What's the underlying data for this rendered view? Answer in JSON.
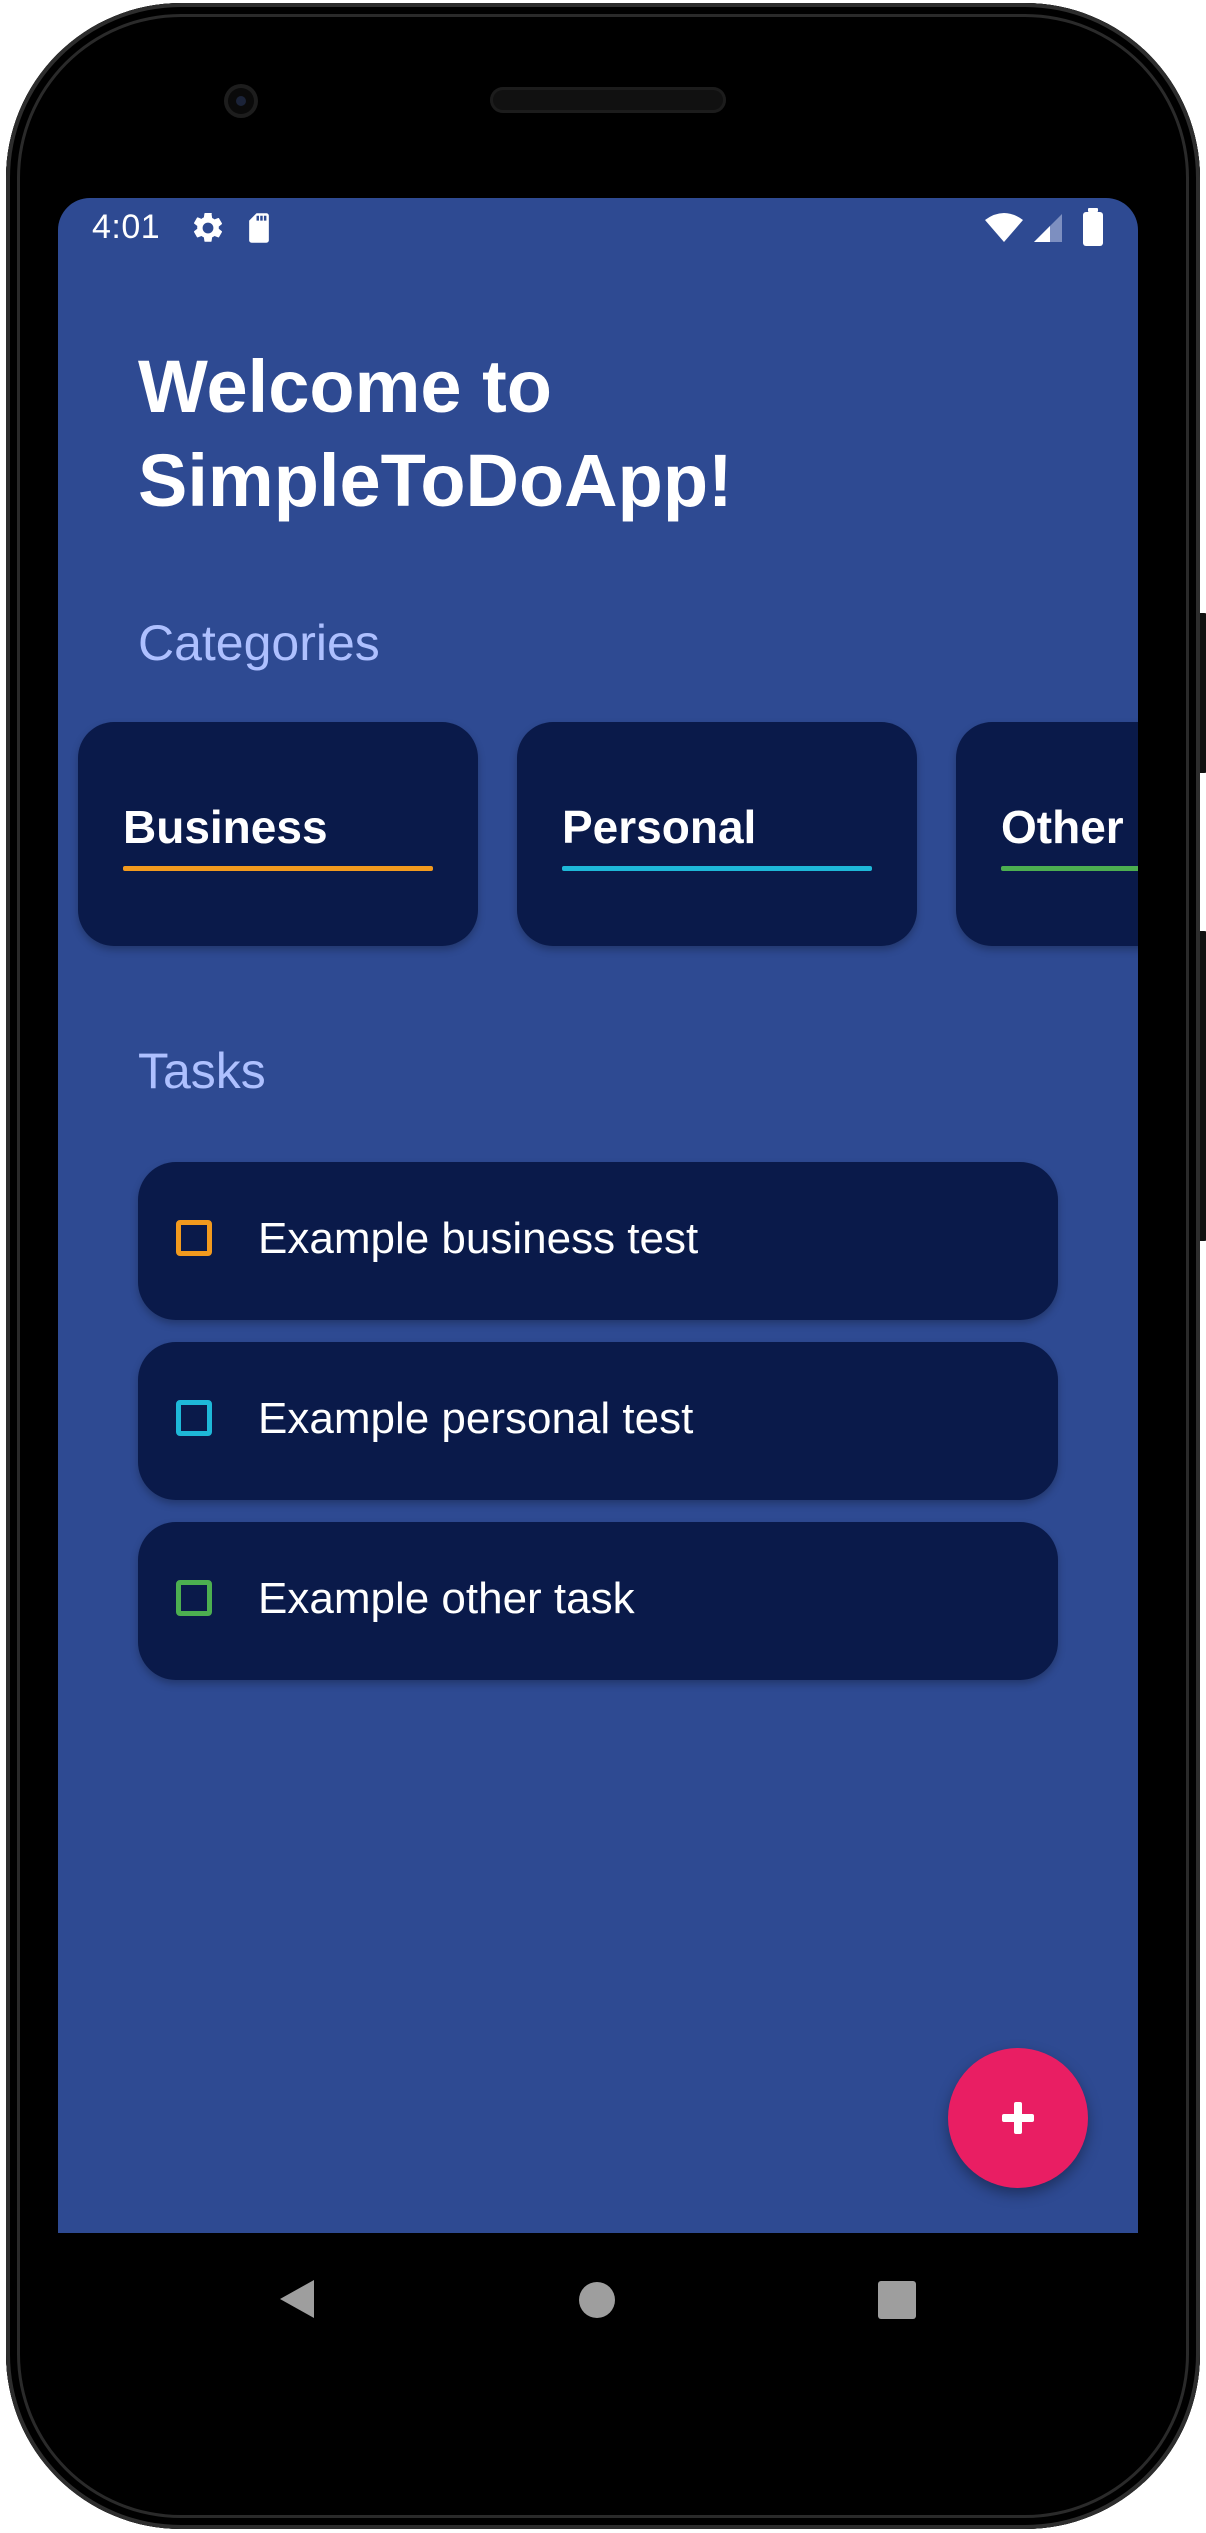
{
  "status_bar": {
    "time": "4:01",
    "left_icons": [
      "gear-icon",
      "sd-card-icon"
    ],
    "right_icons": [
      "wifi-icon",
      "signal-icon",
      "battery-icon"
    ]
  },
  "header": {
    "title_line1": "Welcome to",
    "title_line2": "SimpleToDoApp!"
  },
  "categories": {
    "label": "Categories",
    "items": [
      {
        "label": "Business",
        "color": "#f29a1e"
      },
      {
        "label": "Personal",
        "color": "#1eb8d8"
      },
      {
        "label": "Other",
        "color": "#4caf50"
      }
    ]
  },
  "tasks": {
    "label": "Tasks",
    "items": [
      {
        "label": "Example business test",
        "color": "#f29a1e",
        "checked": false
      },
      {
        "label": "Example personal test",
        "color": "#1eb8d8",
        "checked": false
      },
      {
        "label": "Example other task",
        "color": "#4caf50",
        "checked": false
      }
    ]
  },
  "fab": {
    "icon": "plus-icon",
    "color": "#e91e63"
  },
  "navigation": {
    "icons": [
      "back-icon",
      "home-icon",
      "recents-icon"
    ]
  },
  "theme": {
    "background": "#2e4a92",
    "card": "#0a1a4a",
    "section_label": "#aec0ff"
  }
}
